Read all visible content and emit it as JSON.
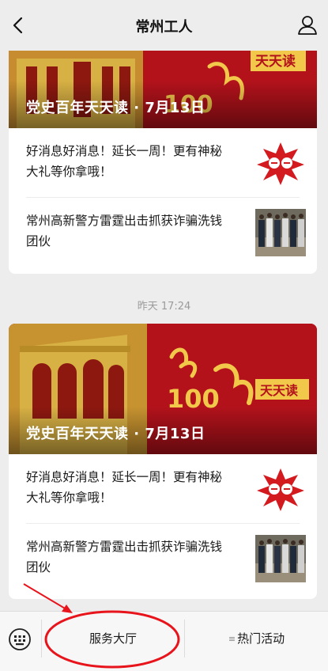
{
  "header": {
    "title": "常州工人",
    "back_icon": "chevron-left-icon",
    "profile_icon": "person-icon"
  },
  "feed": {
    "cards": [
      {
        "banner": {
          "caption": "党史百年天天读 · 7月13日",
          "badge_number": "100",
          "badge_text": "天天读"
        },
        "items": [
          {
            "title": "好消息好消息！延长一周！更有神秘大礼等你拿哦！"
          },
          {
            "title": "常州高新警方雷霆出击抓获诈骗洗钱团伙"
          }
        ]
      },
      {
        "timestamp": "昨天 17:24",
        "banner": {
          "caption": "党史百年天天读 · 7月13日",
          "badge_number": "100",
          "badge_text": "天天读"
        },
        "items": [
          {
            "title": "好消息好消息！延长一周！更有神秘大礼等你拿哦！"
          },
          {
            "title": "常州高新警方雷霆出击抓获诈骗洗钱团伙"
          }
        ]
      }
    ]
  },
  "menu": {
    "keyboard_icon": "keyboard-icon",
    "items": [
      {
        "label": "服务大厅"
      },
      {
        "label": "热门活动",
        "icon": "menu-lines-icon"
      }
    ]
  },
  "colors": {
    "background": "#ededed",
    "banner_red": "#b3121b",
    "annotation_red": "#e8141c"
  }
}
